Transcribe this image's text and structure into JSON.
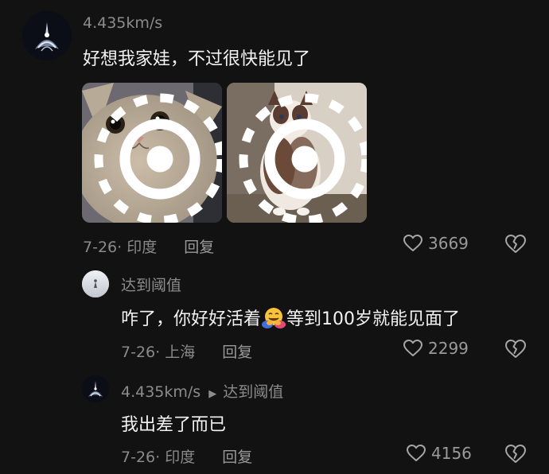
{
  "comments": [
    {
      "username": "4.435km/s",
      "text": "好想我家娃，不过很快能见了",
      "date_location": "7-26· 印度",
      "reply_label": "回复",
      "likes": "3669",
      "photos": [
        "cat-photo-1",
        "cat-photo-2"
      ]
    },
    {
      "username": "达到阈值",
      "text_before_emoji": "咋了，你好好活着",
      "emoji": "hugging-face-emoji",
      "text_after_emoji": "等到100岁就能见面了",
      "date_location": "7-26· 上海",
      "reply_label": "回复",
      "likes": "2299"
    },
    {
      "username": "4.435km/s",
      "reply_to": "达到阈值",
      "text": "我出差了而已",
      "date_location": "7-26· 印度",
      "reply_label": "回复",
      "likes": "4156"
    }
  ],
  "icons": {
    "like": "heart-outline-icon",
    "dislike": "broken-heart-icon",
    "reply_arrow": "triangle-right-icon",
    "live_photo": "live-photo-icon"
  },
  "colors": {
    "background": "#121212",
    "primary_text": "#f2f2f2",
    "secondary_text": "#8c8c8c"
  }
}
